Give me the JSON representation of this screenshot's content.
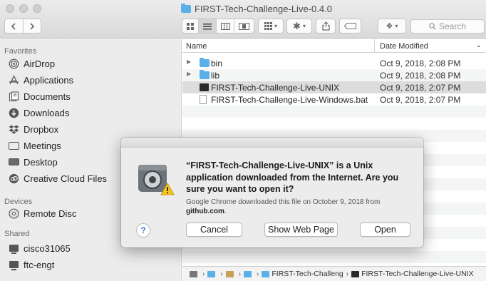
{
  "window": {
    "title": "FIRST-Tech-Challenge-Live-0.4.0",
    "search_placeholder": "Search"
  },
  "sidebar": {
    "favorites_header": "Favorites",
    "favorites": [
      {
        "label": "AirDrop",
        "icon": "airdrop-icon"
      },
      {
        "label": "Applications",
        "icon": "applications-icon"
      },
      {
        "label": "Documents",
        "icon": "documents-icon"
      },
      {
        "label": "Downloads",
        "icon": "downloads-icon"
      },
      {
        "label": "Dropbox",
        "icon": "dropbox-icon"
      },
      {
        "label": "Meetings",
        "icon": "folder-icon"
      },
      {
        "label": "Desktop",
        "icon": "desktop-icon"
      },
      {
        "label": "Creative Cloud Files",
        "icon": "creative-cloud-icon"
      }
    ],
    "devices_header": "Devices",
    "devices": [
      {
        "label": "Remote Disc",
        "icon": "disc-icon"
      }
    ],
    "shared_header": "Shared",
    "shared": [
      {
        "label": "cisco31065",
        "icon": "computer-icon"
      },
      {
        "label": "ftc-engt",
        "icon": "computer-icon"
      }
    ]
  },
  "list": {
    "col_name": "Name",
    "col_date": "Date Modified",
    "rows": [
      {
        "name": "bin",
        "date": "Oct 9, 2018, 2:08 PM",
        "kind": "folder"
      },
      {
        "name": "lib",
        "date": "Oct 9, 2018, 2:08 PM",
        "kind": "folder"
      },
      {
        "name": "FIRST-Tech-Challenge-Live-UNIX",
        "date": "Oct 9, 2018, 2:07 PM",
        "kind": "exec"
      },
      {
        "name": "FIRST-Tech-Challenge-Live-Windows.bat",
        "date": "Oct 9, 2018, 2:07 PM",
        "kind": "doc"
      }
    ]
  },
  "pathbar": {
    "seg_folder": "FIRST-Tech-Challeng",
    "seg_file": "FIRST-Tech-Challenge-Live-UNIX"
  },
  "dialog": {
    "message": "“FIRST-Tech-Challenge-Live-UNIX” is a Unix application downloaded from the Internet. Are you sure you want to open it?",
    "info_prefix": "Google Chrome downloaded this file on October 9, 2018 from ",
    "info_source": "github.com",
    "info_suffix": ".",
    "help_label": "?",
    "cancel_label": "Cancel",
    "show_web_label": "Show Web Page",
    "open_label": "Open"
  }
}
